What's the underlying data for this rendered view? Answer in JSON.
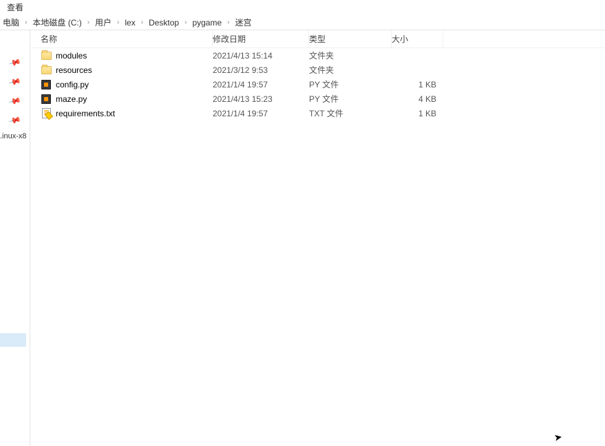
{
  "toolbar": {
    "tab_label": "查看"
  },
  "breadcrumb": [
    "电脑",
    "本地磁盘 (C:)",
    "用户",
    "lex",
    "Desktop",
    "pygame",
    "迷宫"
  ],
  "sidebar": {
    "truncated_item": ".inux-x8"
  },
  "columns": {
    "name": "名称",
    "date": "修改日期",
    "type": "类型",
    "size": "大小"
  },
  "files": [
    {
      "icon": "folder",
      "name": "modules",
      "date": "2021/4/13 15:14",
      "type": "文件夹",
      "size": ""
    },
    {
      "icon": "folder",
      "name": "resources",
      "date": "2021/3/12 9:53",
      "type": "文件夹",
      "size": ""
    },
    {
      "icon": "py",
      "name": "config.py",
      "date": "2021/1/4 19:57",
      "type": "PY 文件",
      "size": "1 KB"
    },
    {
      "icon": "py",
      "name": "maze.py",
      "date": "2021/4/13 15:23",
      "type": "PY 文件",
      "size": "4 KB"
    },
    {
      "icon": "txt",
      "name": "requirements.txt",
      "date": "2021/1/4 19:57",
      "type": "TXT 文件",
      "size": "1 KB"
    }
  ]
}
